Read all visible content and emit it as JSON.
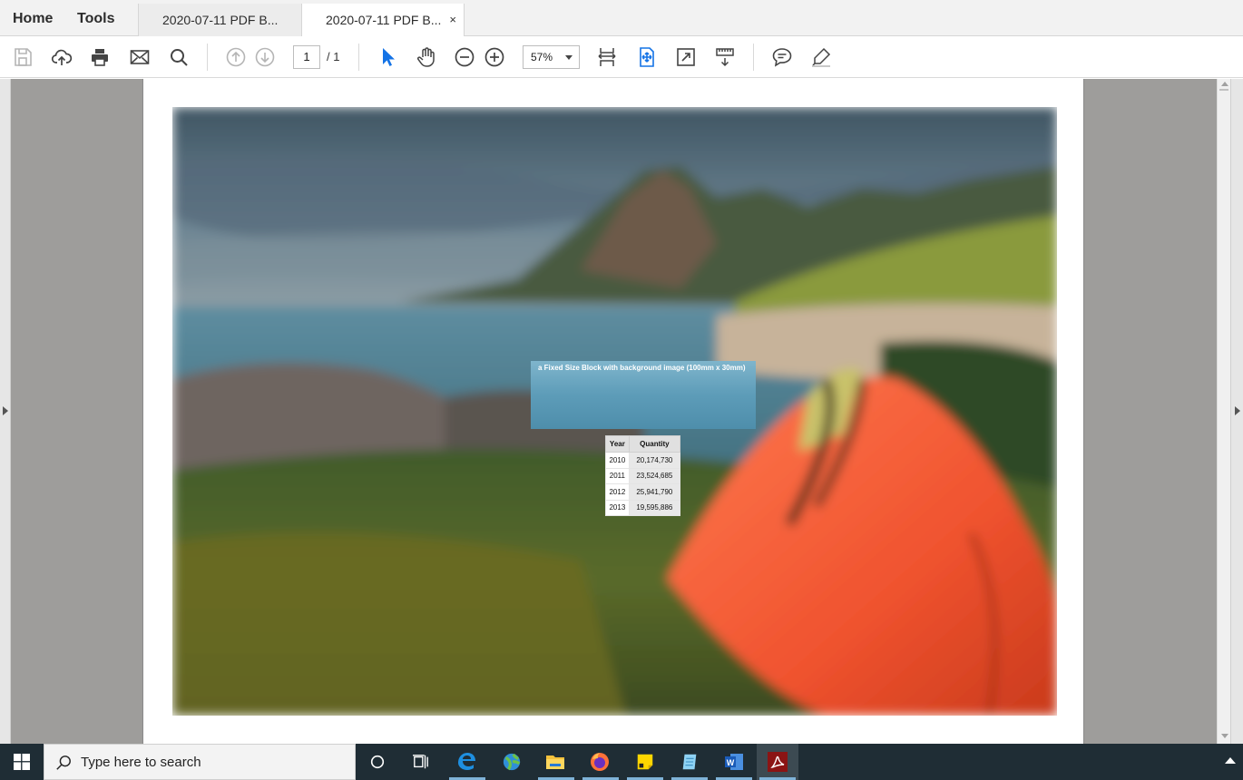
{
  "nav": {
    "home": "Home",
    "tools": "Tools"
  },
  "tabs": [
    {
      "label": "2020-07-11 PDF B..."
    },
    {
      "label": "2020-07-11 PDF B...",
      "close": "×"
    }
  ],
  "toolbar": {
    "page_current": "1",
    "page_total": "/ 1",
    "zoom": "57%"
  },
  "document": {
    "block_caption": "a Fixed Size Block with background image (100mm x 30mm)",
    "table": {
      "headers": [
        "Year",
        "Quantity"
      ],
      "rows": [
        [
          "2010",
          "20,174,730"
        ],
        [
          "2011",
          "23,524,685"
        ],
        [
          "2012",
          "25,941,790"
        ],
        [
          "2013",
          "19,595,886"
        ]
      ]
    }
  },
  "taskbar": {
    "search_placeholder": "Type here to search",
    "icons": [
      "windows-start-icon",
      "cortana-icon",
      "task-view-icon",
      "edge-icon",
      "globe-browser-icon",
      "file-explorer-icon",
      "firefox-icon",
      "sticky-notes-icon",
      "notepad-icon",
      "word-icon",
      "acrobat-icon"
    ]
  },
  "colors": {
    "accent_blue": "#1473e6",
    "taskbar": "#1f2d35",
    "tent_orange": "#f0532f"
  }
}
